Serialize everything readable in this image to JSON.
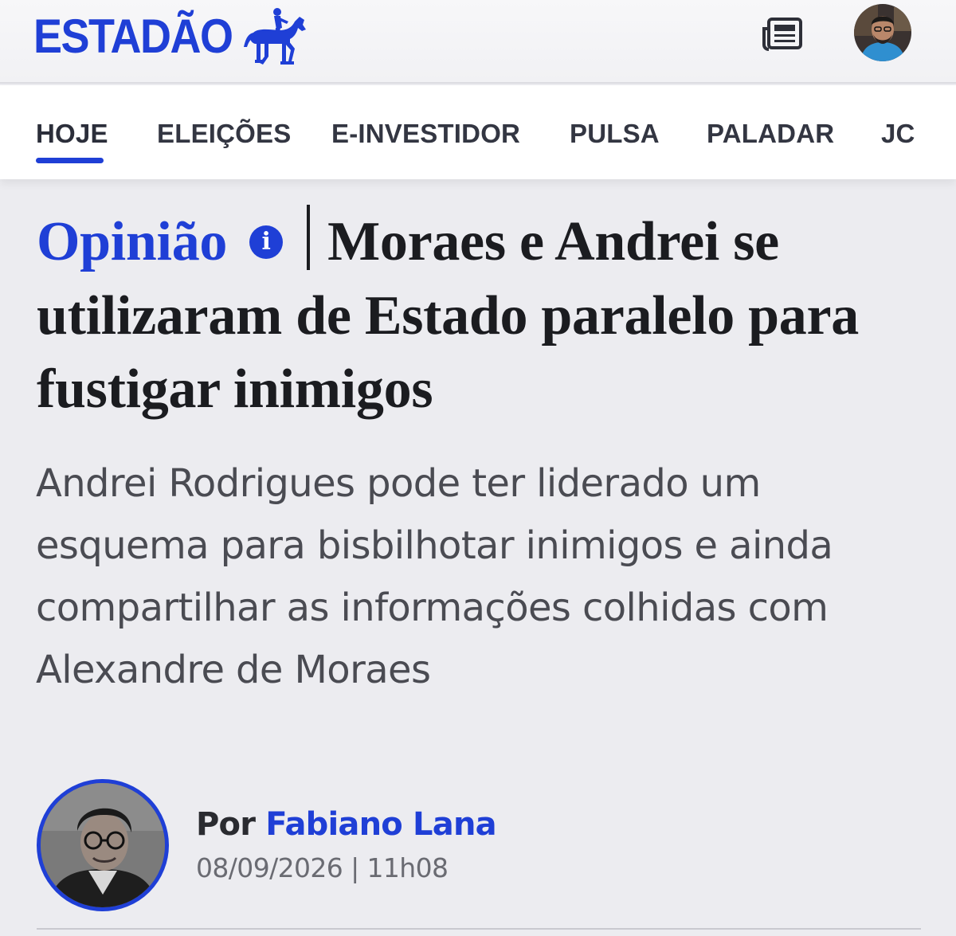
{
  "header": {
    "logo_text": "ESTADÃO",
    "brand_color": "#1f3fd6"
  },
  "nav": {
    "items": [
      {
        "label": "HOJE",
        "active": true
      },
      {
        "label": "ELEIÇÕES"
      },
      {
        "label": "E-INVESTIDOR"
      },
      {
        "label": "PULSA"
      },
      {
        "label": "PALADAR"
      },
      {
        "label": "JC"
      }
    ]
  },
  "article": {
    "kicker": "Opinião",
    "title": "Moraes e Andrei se utilizaram de Estado paralelo para fustigar inimigos",
    "subtitle": "Andrei Rodrigues pode ter liderado um esquema para bisbilhotar inimigos e ainda compartilhar as informações colhidas com Alexandre de Moraes",
    "byline_prefix": "Por",
    "author": "Fabiano Lana",
    "date": "08/09/2026 | 11h08"
  },
  "icons": [
    "horse-rider-logo-icon",
    "newspaper-icon",
    "user-avatar",
    "info-icon"
  ]
}
